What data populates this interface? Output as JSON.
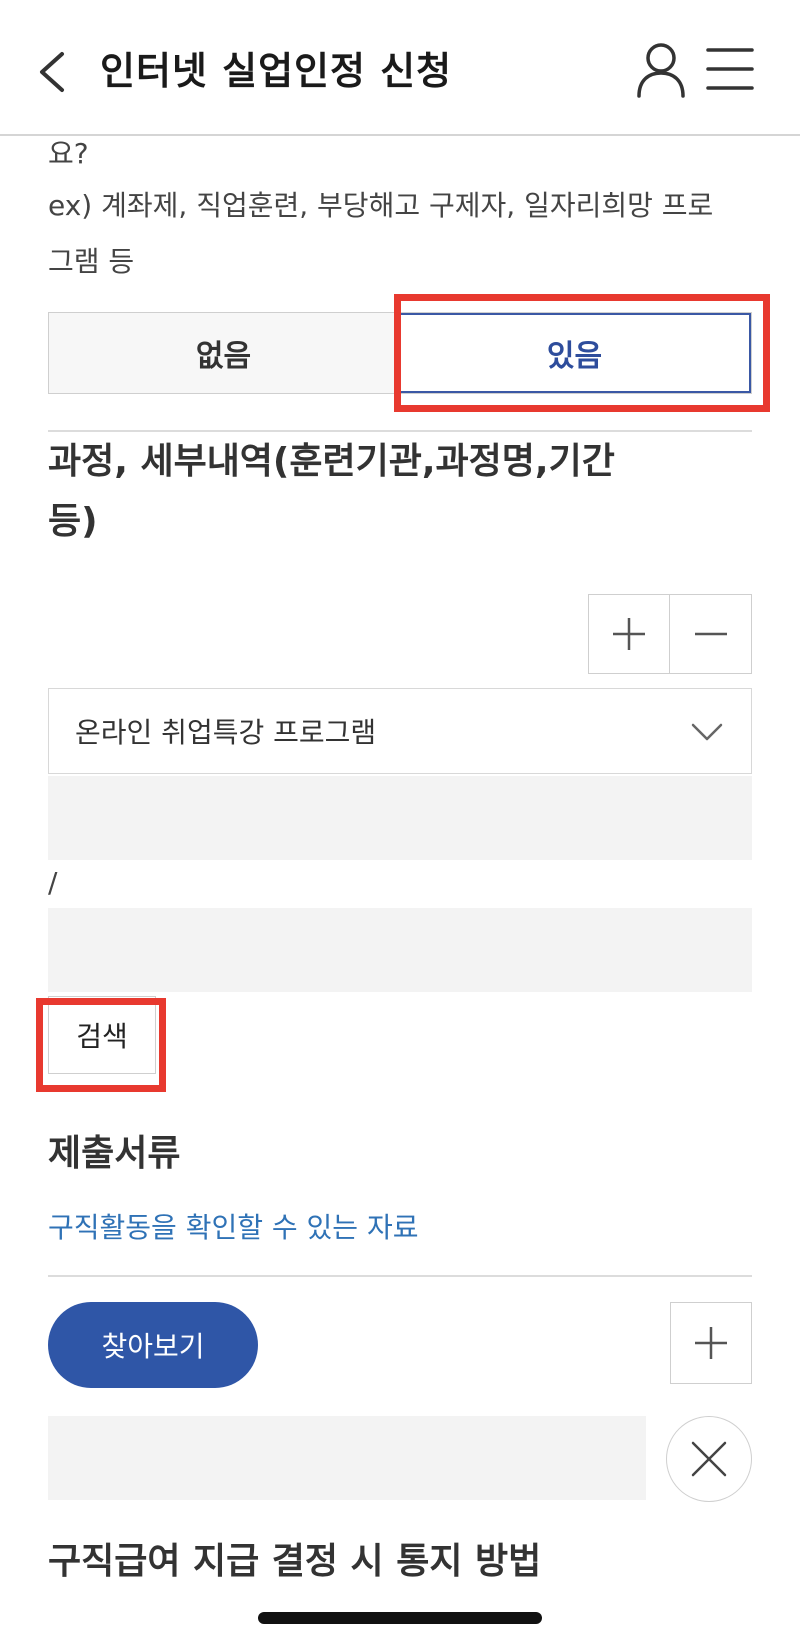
{
  "header": {
    "title": "인터넷 실업인정 신청"
  },
  "question": {
    "line1": "요?",
    "line2": "ex) 계좌제, 직업훈련, 부당해고 구제자, 일자리희망 프로",
    "line3": "그램 등"
  },
  "toggle": {
    "no_label": "없음",
    "yes_label": "있음",
    "selected": "있음"
  },
  "course": {
    "title_line1": "과정, 세부내역(훈련기관,과정명,기간",
    "title_line2": "등)",
    "select_value": "온라인 취업특강 프로그램",
    "separator": "/",
    "search_label": "검색"
  },
  "documents": {
    "title": "제출서류",
    "subtitle": "구직활동을 확인할 수 있는 자료",
    "find_label": "찾아보기"
  },
  "notify": {
    "title": "구직급여 지급 결정 시 통지 방법"
  },
  "colors": {
    "accent": "#2f56a7",
    "highlight": "#e8392f",
    "link": "#2f72b6"
  }
}
